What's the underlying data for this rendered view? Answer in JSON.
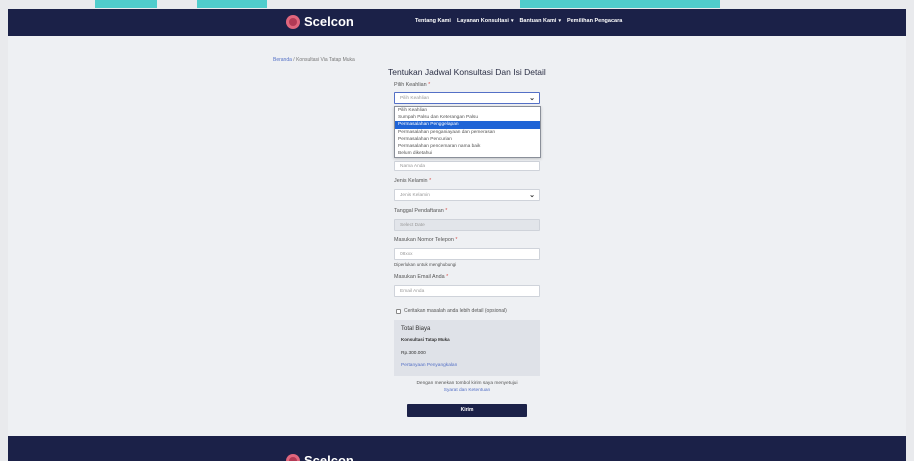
{
  "nav": {
    "brand": "Scelcon",
    "links": [
      {
        "label": "Tentang Kami",
        "caret": false
      },
      {
        "label": "Layanan Konsultasi",
        "caret": true
      },
      {
        "label": "Bantuan Kami",
        "caret": true
      },
      {
        "label": "Pemilihan Pengacara",
        "caret": false
      }
    ]
  },
  "breadcrumb": {
    "home": "Beranda",
    "sep": "/",
    "current": "Konsultasi Via Tatap Muka"
  },
  "form": {
    "title": "Tentukan Jadwal Konsultasi Dan Isi Detail",
    "keahlian": {
      "label": "Pilih Keahlian",
      "value": "Pilih Keahlian"
    },
    "dropdown_options": [
      "Pilih Keahlian",
      "Sumpah Palsu dan Keterangan Palsu",
      "Permasalahan Penggelapan",
      "Permasalahan penganiayaan dan pemerasan",
      "Permasalahan Pencurian",
      "Permasalahan pencemaran nama baik",
      "Belum diketahui"
    ],
    "dropdown_selected_index": 2,
    "nama_placeholder": "Nama Anda",
    "gender": {
      "label": "Jenis Kelamin",
      "value": "Jenis Kelamin"
    },
    "date": {
      "label": "Tanggal Pendaftaran",
      "placeholder": "Select Date"
    },
    "phone": {
      "label": "Masukan Nomor Telepon",
      "placeholder": "08xxx",
      "hint": "Diperlukan untuk menghubungi"
    },
    "email": {
      "label": "Masukan Email Anda",
      "placeholder": "Email Anda"
    },
    "required_mark": "*",
    "detail_checkbox": "Ceritakan masalah anda lebih detail (opsional)",
    "cost": {
      "title": "Total Biaya",
      "type": "Konsultasi Tatap Muka",
      "price": "Rp.300.000",
      "note": "Pertanyaan Penyangkalan"
    },
    "agree_text": "Dengan menekan tombol kirim saya menyetujui",
    "agree_link": "Syarat dan Ketentuan",
    "submit": "Kirim"
  },
  "footer": {
    "brand": "Scelcon"
  },
  "colors": {
    "navy": "#1b2148",
    "accent_link": "#5470c6",
    "selected": "#1f64d6",
    "logo": "#e0667d"
  }
}
